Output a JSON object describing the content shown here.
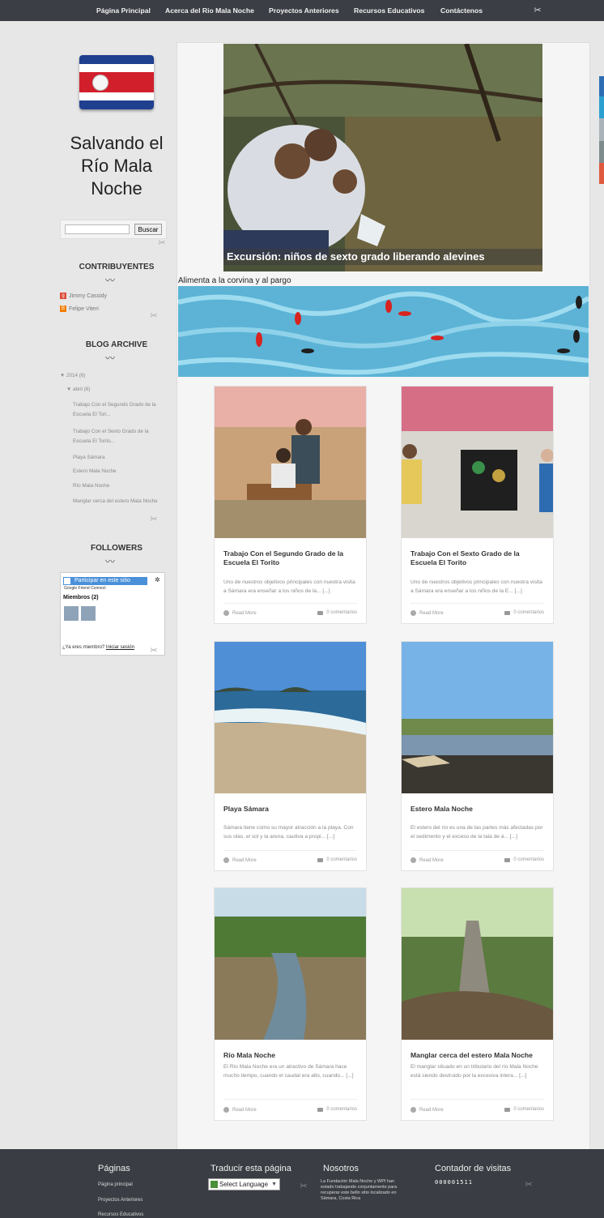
{
  "nav": {
    "items": [
      "Página Principal",
      "Acerca del Rio Mala Noche",
      "Proyectos Anteriores",
      "Recursos Educativos",
      "Contáctenos"
    ]
  },
  "sidebar": {
    "site_title": "Salvando el Río Mala Noche",
    "search": {
      "value": "",
      "button": "Buscar"
    },
    "contributors_title": "CONTRIBUYENTES",
    "contributors": [
      "Jimmy Cassidy",
      "Felipe Viteri"
    ],
    "archive_title": "BLOG ARCHIVE",
    "archive_year": "▼ 2014 (6)",
    "archive_month": "▼ abril (6)",
    "archive_posts": [
      "Trabajo Con el Segundo Grado de la Escuela El Tori...",
      "Trabajo Con el Sexto Grado de la Escuela El Torito...",
      "Playa Sámara",
      "Estero Mala Noche",
      "Río Mala Noche",
      "Manglar cerca del estero Mala Noche"
    ],
    "followers_title": "FOLLOWERS",
    "followers": {
      "join_button": "Participar en este sitio",
      "gfc": "Google Friend Connect",
      "members": "Miembros (2)",
      "already": "¿Ya eres miembro?",
      "signin": "Iniciar sesión"
    }
  },
  "main": {
    "hero_caption": "Excursión: niños de sexto grado liberando alevines",
    "fish_label": "Alimenta a la corvina y al pargo",
    "read_more": "Read More",
    "comments": "0 comentarios",
    "posts": [
      {
        "title": "Trabajo Con el Segundo Grado de la Escuela El Torito",
        "excerpt": "Uno de nuestros objetivos principales con nuestra visita a Sámara era enseñar a los niños de la... [...]"
      },
      {
        "title": "Trabajo Con el Sexto Grado de la Escuela El Torito",
        "excerpt": "Uno de nuestros objetivos principales con nuestra visita a Sámara era enseñar a los niños de la E... [...]"
      },
      {
        "title": "Playa Sámara",
        "excerpt": "Sámara tiene como su mayor atracción a la playa. Con sus olas, el sol y la arena, cautiva a propi... [...]"
      },
      {
        "title": "Estero Mala Noche",
        "excerpt": "El estero del río es una de las partes más afectadas por el sedimento y el exceso de la tala de á... [...]"
      },
      {
        "title": "Río Mala Noche",
        "excerpt": "El Río Mala Noche era un atractivo de Sámara hace mucho tiempo, cuando el caudal era alto, cuando... [...]"
      },
      {
        "title": "Manglar cerca del estero Mala Noche",
        "excerpt": "El manglar situado en un tributario del río Mala Noche está siendo destruido por la excesiva intera... [...]"
      }
    ]
  },
  "footer": {
    "pages_title": "Páginas",
    "pages": [
      "Página principal",
      "Proyectos Anteriores",
      "Recursos Educativos"
    ],
    "translate_title": "Traducir esta página",
    "translate_select": "Select Language",
    "about_title": "Nosotros",
    "about_text": "La Fundación Mala Noche y WPI han estado trabajando conjuntamente para recuperar este bello sitio localizado en Sámara, Costa Rica",
    "counter_title": "Contador de visitas",
    "counter_value": "000001511"
  },
  "colors": {
    "topbar": "#3b3e44",
    "footer": "#3a3d43",
    "flag_blue": "#1f3f8f",
    "flag_red": "#d21f2c"
  }
}
